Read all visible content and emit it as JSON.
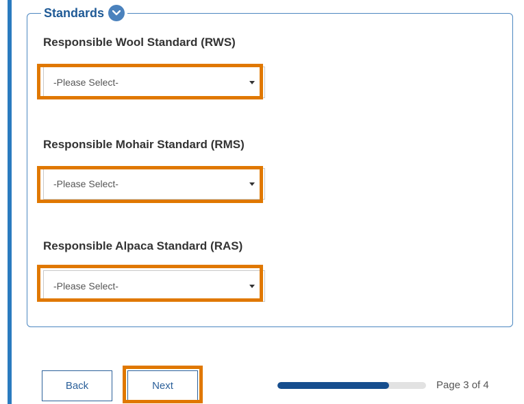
{
  "section": {
    "title": "Standards",
    "icon": "chevron-down-circle-icon"
  },
  "fields": [
    {
      "label": "Responsible Wool Standard (RWS)",
      "value": "-Please Select-"
    },
    {
      "label": "Responsible Mohair Standard (RMS)",
      "value": "-Please Select-"
    },
    {
      "label": "Responsible Alpaca Standard (RAS)",
      "value": "-Please Select-"
    }
  ],
  "nav": {
    "back_label": "Back",
    "next_label": "Next"
  },
  "progress": {
    "fraction": 0.75,
    "label": "Page 3 of 4"
  },
  "colors": {
    "accent": "#2a7bbf",
    "highlight": "#e07800",
    "progress_fill": "#164e8e",
    "button_border": "#2a5f99"
  }
}
